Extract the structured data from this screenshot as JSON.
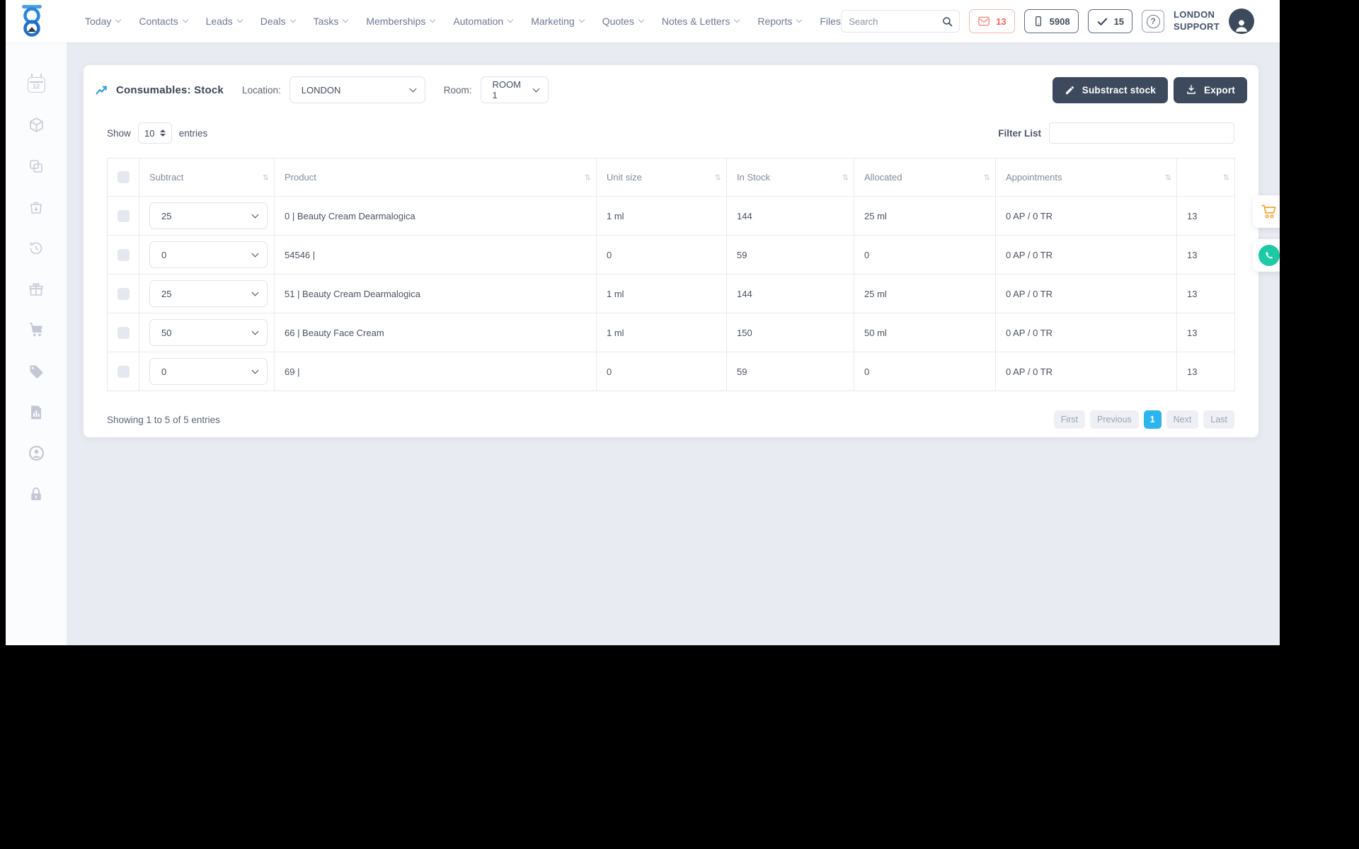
{
  "nav": {
    "items": [
      {
        "label": "Today",
        "has_dropdown": true
      },
      {
        "label": "Contacts",
        "has_dropdown": true
      },
      {
        "label": "Leads",
        "has_dropdown": true
      },
      {
        "label": "Deals",
        "has_dropdown": true
      },
      {
        "label": "Tasks",
        "has_dropdown": true
      },
      {
        "label": "Memberships",
        "has_dropdown": true
      },
      {
        "label": "Automation",
        "has_dropdown": true
      },
      {
        "label": "Marketing",
        "has_dropdown": true
      },
      {
        "label": "Quotes",
        "has_dropdown": true
      },
      {
        "label": "Notes & Letters",
        "has_dropdown": true
      },
      {
        "label": "Reports",
        "has_dropdown": true
      },
      {
        "label": "Files",
        "has_dropdown": false
      }
    ],
    "search_placeholder": "Search",
    "badges": {
      "messages": "13",
      "phone": "5908",
      "tasks": "15"
    },
    "user": {
      "line1": "LONDON",
      "line2": "SUPPORT"
    }
  },
  "sidebar": {
    "calendar_day": "12",
    "icons": [
      "calendar",
      "package",
      "copy",
      "shopping-bag",
      "history",
      "gift",
      "cart",
      "price-tag",
      "report",
      "account",
      "lock"
    ]
  },
  "page": {
    "title": "Consumables: Stock",
    "location_label": "Location:",
    "location_value": "LONDON",
    "room_label": "Room:",
    "room_value": "ROOM 1",
    "subtract_stock_button": "Substract stock",
    "export_button": "Export"
  },
  "list_controls": {
    "show_label": "Show",
    "show_value": "10",
    "entries_label": "entries",
    "filter_label": "Filter List",
    "filter_value": ""
  },
  "table": {
    "headers": [
      "Subtract",
      "Product",
      "Unit size",
      "In Stock",
      "Allocated",
      "Appointments",
      ""
    ],
    "rows": [
      {
        "subtract": "25",
        "product": "0 | Beauty Cream Dearmalogica",
        "unit_size": "1 ml",
        "in_stock": "144",
        "allocated": "25 ml",
        "appointments": "0 AP / 0 TR",
        "last_col": "13"
      },
      {
        "subtract": "0",
        "product": "54546 |",
        "unit_size": "0",
        "in_stock": "59",
        "allocated": "0",
        "appointments": "0 AP / 0 TR",
        "last_col": "13"
      },
      {
        "subtract": "25",
        "product": "51 | Beauty Cream Dearmalogica",
        "unit_size": "1 ml",
        "in_stock": "144",
        "allocated": "25 ml",
        "appointments": "0 AP / 0 TR",
        "last_col": "13"
      },
      {
        "subtract": "50",
        "product": "66 | Beauty Face Cream",
        "unit_size": "1 ml",
        "in_stock": "150",
        "allocated": "50 ml",
        "appointments": "0 AP / 0 TR",
        "last_col": "13"
      },
      {
        "subtract": "0",
        "product": "69 |",
        "unit_size": "0",
        "in_stock": "59",
        "allocated": "0",
        "appointments": "0 AP / 0 TR",
        "last_col": "13"
      }
    ],
    "summary": "Showing 1 to 5 of 5 entries"
  },
  "pagination": {
    "first": "First",
    "previous": "Previous",
    "page": "1",
    "next": "Next",
    "last": "Last"
  },
  "colors": {
    "brand_blue": "#2b86e0",
    "dark_slate": "#3d4a5d",
    "active_page_blue": "#2cb4ee",
    "alert_salmon": "#f0655c",
    "floating_cart_orange": "#f5a93b",
    "floating_chat_teal": "#1ec9a6",
    "content_background": "#e9ebf2"
  }
}
